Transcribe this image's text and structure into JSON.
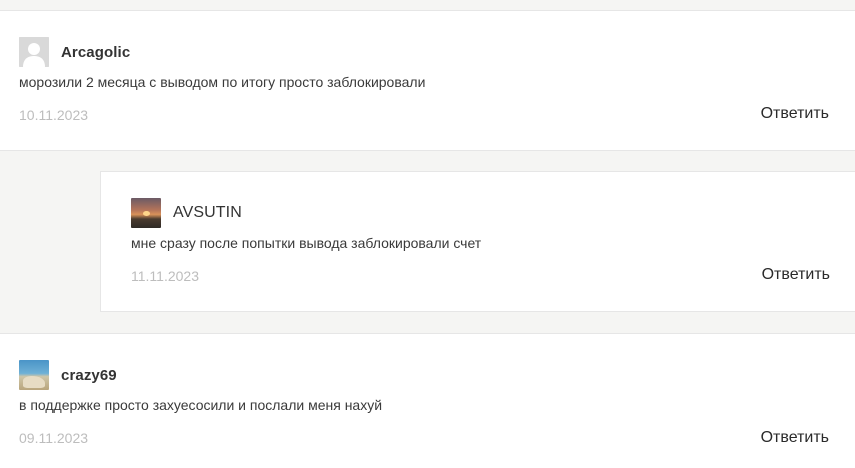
{
  "comments": [
    {
      "author": "Arcagolic",
      "text": "морозили 2 месяца с выводом по итогу просто заблокировали",
      "date": "10.11.2023",
      "reply_label": "Ответить",
      "avatar": "default-user-icon"
    },
    {
      "author": "AVSUTIN",
      "text": "мне сразу после попытки вывода заблокировали счет",
      "date": "11.11.2023",
      "reply_label": "Ответить",
      "avatar": "sunset-photo"
    },
    {
      "author": "crazy69",
      "text": "в поддержке просто захуесосили и послали меня нахуй",
      "date": "09.11.2023",
      "reply_label": "Ответить",
      "avatar": "beach-photo"
    }
  ],
  "colors": {
    "background": "#f5f5f3",
    "card": "#ffffff",
    "date": "#bdbdbd",
    "text": "#333333"
  }
}
